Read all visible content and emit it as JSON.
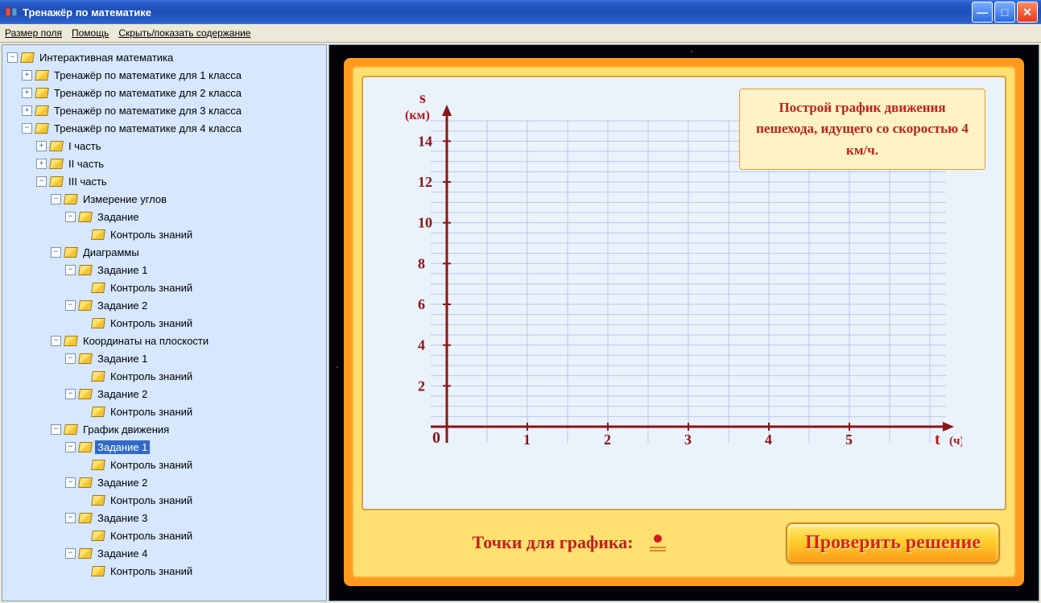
{
  "window": {
    "title": "Тренажёр по математике"
  },
  "menu": {
    "field_size": "Размер поля",
    "help": "Помощь",
    "toggle_toc": "Скрыть/показать содержание"
  },
  "tree": {
    "root": "Интерактивная математика",
    "grade1": "Тренажёр по математике для 1 класса",
    "grade2": "Тренажёр по математике для 2 класса",
    "grade3": "Тренажёр по математике для 3 класса",
    "grade4": "Тренажёр по математике для 4 класса",
    "part1": "I часть",
    "part2": "II часть",
    "part3": "III часть",
    "angles": "Измерение углов",
    "task": "Задание",
    "task1": "Задание 1",
    "task2": "Задание 2",
    "task3": "Задание 3",
    "task4": "Задание 4",
    "check": "Контроль знаний",
    "diagrams": "Диаграммы",
    "coords": "Координаты на плоскости",
    "motion": "График движения"
  },
  "task": {
    "instruction": "Построй график движения пешехода, идущего со скоростью 4 км/ч.",
    "points_label": "Точки для графика:",
    "check_button": "Проверить решение"
  },
  "chart_data": {
    "type": "line",
    "title": "",
    "xlabel": "t",
    "xunit": "(ч)",
    "ylabel": "s",
    "yunit": "(км)",
    "origin": "0",
    "x_ticks": [
      "1",
      "2",
      "3",
      "4",
      "5"
    ],
    "y_ticks": [
      "2",
      "4",
      "6",
      "8",
      "10",
      "12",
      "14"
    ],
    "xlim": [
      0,
      6
    ],
    "ylim": [
      0,
      15
    ],
    "series": []
  }
}
